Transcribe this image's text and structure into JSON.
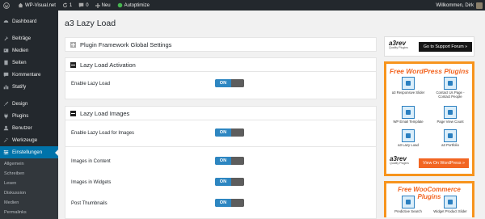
{
  "adminbar": {
    "site": "WP-Visual.net",
    "updates": "1",
    "comments": "0",
    "new": "Neu",
    "autoptimize": "Autoptimize",
    "greeting": "Willkommen, Dirk"
  },
  "menu": {
    "dashboard": "Dashboard",
    "posts": "Beiträge",
    "media": "Medien",
    "pages": "Seiten",
    "comments": "Kommentare",
    "statify": "Statify",
    "design": "Design",
    "plugins": "Plugins",
    "users": "Benutzer",
    "tools": "Werkzeuge",
    "settings": "Einstellungen",
    "sub": [
      "Allgemein",
      "Schreiben",
      "Lesen",
      "Diskussion",
      "Medien",
      "Permalinks"
    ]
  },
  "page": {
    "title": "a3 Lazy Load"
  },
  "sections": {
    "framework": "Plugin Framework Global Settings",
    "activation": {
      "title": "Lazy Load Activation",
      "rows": [
        {
          "label": "Enable Lazy Load",
          "state": "ON"
        }
      ]
    },
    "images": {
      "title": "Lazy Load Images",
      "rows": [
        {
          "label": "Enable Lazy Load for Images",
          "state": "ON"
        },
        {
          "label": "Images in Content",
          "state": "ON"
        },
        {
          "label": "Images in Widgets",
          "state": "ON"
        },
        {
          "label": "Post Thumbnails",
          "state": "ON"
        }
      ]
    }
  },
  "promo": {
    "logo": "a3rev",
    "logo_sub": "Quality Plugins",
    "support_btn": "Go to Support Forum »",
    "free_wp": "Free WordPress Plugins",
    "wp_plugins": [
      "a3 Responsive Slider",
      "Contact Us Page - Contact People",
      "WP Email Template",
      "Page View Count",
      "a3 Lazy Load",
      "a3 Portfolio"
    ],
    "view_btn": "View On WordPress »",
    "free_woo": "Free WooCommerce Plugins",
    "woo_plugins": [
      "Predictive Search",
      "Widget Product Slider"
    ]
  },
  "colors": {
    "admin_dark": "#23282d",
    "accent": "#0073aa",
    "toggle_on": "#2d86c1",
    "promo_orange": "#f7941d"
  }
}
